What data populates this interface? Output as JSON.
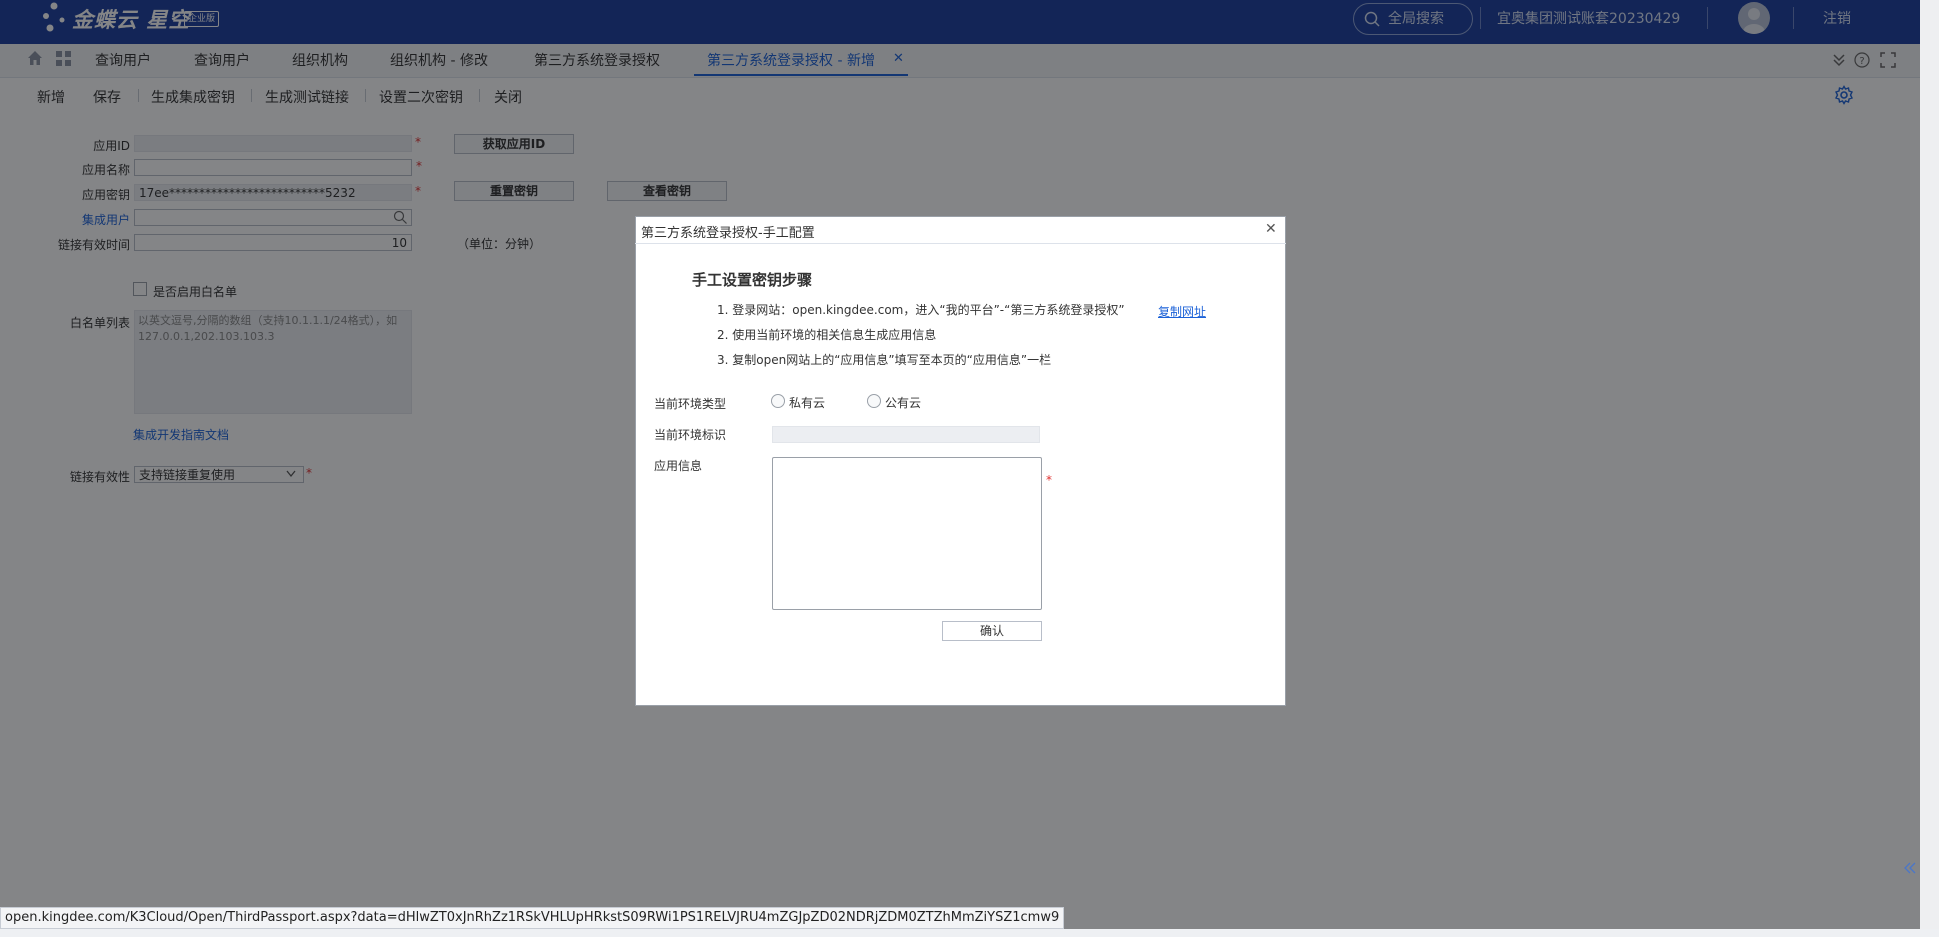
{
  "header": {
    "logo_text": "金蝶云 星空",
    "logo_badge": "企业版",
    "search_label": "全局搜索",
    "tenant": "宜奥集团测试账套20230429",
    "logout": "注销"
  },
  "tabs": [
    {
      "label": "查询用户"
    },
    {
      "label": "查询用户"
    },
    {
      "label": "组织机构"
    },
    {
      "label": "组织机构 - 修改"
    },
    {
      "label": "第三方系统登录授权"
    },
    {
      "label": "第三方系统登录授权 - 新增",
      "active": true
    }
  ],
  "toolbar": {
    "new": "新增",
    "save": "保存",
    "gen_key": "生成集成密钥",
    "gen_link": "生成测试链接",
    "set_secondary": "设置二次密钥",
    "close": "关闭"
  },
  "form": {
    "app_id_label": "应用ID",
    "app_name_label": "应用名称",
    "app_secret_label": "应用密钥",
    "app_secret_value": "17ee**************************5232",
    "integration_user_label": "集成用户",
    "link_validity_label": "链接有效时间",
    "link_validity_value": "10",
    "unit_hint": "（单位：分钟）",
    "get_app_id_btn": "获取应用ID",
    "reset_secret_btn": "重置密钥",
    "view_secret_btn": "查看密钥",
    "whitelist_checkbox": "是否启用白名单",
    "whitelist_label": "白名单列表",
    "whitelist_placeholder": "以英文逗号,分隔的数组（支持10.1.1.1/24格式），如127.0.0.1,202.103.103.3",
    "guide_link": "集成开发指南文档",
    "link_effect_label": "链接有效性",
    "link_effect_value": "支持链接重复使用",
    "required_mark": "*"
  },
  "dialog": {
    "title": "第三方系统登录授权-手工配置",
    "heading": "手工设置密钥步骤",
    "step1": "1. 登录网站：open.kingdee.com，进入“我的平台”-“第三方系统登录授权”",
    "copy_link": "复制网址",
    "step2": "2. 使用当前环境的相关信息生成应用信息",
    "step3": "3. 复制open网站上的“应用信息”填写至本页的“应用信息”一栏",
    "env_type_label": "当前环境类型",
    "private_cloud": "私有云",
    "public_cloud": "公有云",
    "env_id_label": "当前环境标识",
    "app_info_label": "应用信息",
    "confirm_btn": "确认"
  },
  "status_url": "open.kingdee.com/K3Cloud/Open/ThirdPassport.aspx?data=dHlwZT0xJnRhZz1RSkVHLUpHRkstS09RWi1PS1RELVJRU4mZGJpZD02NDRjZDM0ZTZhMmZiYSZ1cmw9",
  "colors": {
    "header_bg": "#1c3f9e",
    "accent": "#1c62d8",
    "required": "#e03030"
  }
}
